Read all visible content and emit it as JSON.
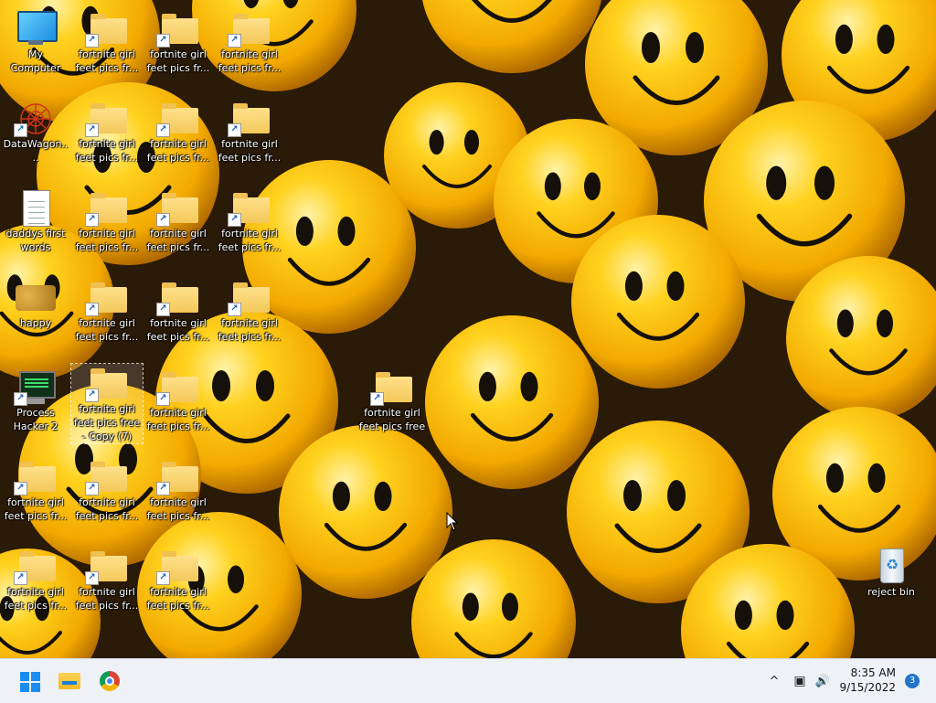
{
  "desktop": {
    "wallpaper": "yellow smiley face balls",
    "cursor": "arrow-pointer",
    "icons": [
      {
        "label": "My Computer",
        "type": "computer"
      },
      {
        "label": "fortnite girl feet pics fr...",
        "type": "folder-shortcut"
      },
      {
        "label": "fortnite girl feet pics fr...",
        "type": "folder-shortcut"
      },
      {
        "label": "fortnite girl feet pics fr...",
        "type": "folder-shortcut"
      },
      {
        "label": "DataWagon....",
        "type": "app-shortcut"
      },
      {
        "label": "fortnite girl feet pics fr...",
        "type": "folder-shortcut"
      },
      {
        "label": "fortnite girl feet pics fr...",
        "type": "folder-shortcut"
      },
      {
        "label": "fortnite girl feet pics fr...",
        "type": "folder-shortcut"
      },
      {
        "label": "daddys first words",
        "type": "text-document"
      },
      {
        "label": "fortnite girl feet pics fr...",
        "type": "folder-shortcut"
      },
      {
        "label": "fortnite girl feet pics fr...",
        "type": "folder-shortcut"
      },
      {
        "label": "fortnite girl feet pics fr...",
        "type": "folder-shortcut"
      },
      {
        "label": "happy",
        "type": "image"
      },
      {
        "label": "fortnite girl feet pics fr...",
        "type": "folder-shortcut"
      },
      {
        "label": "fortnite girl feet pics fr...",
        "type": "folder-shortcut"
      },
      {
        "label": "fortnite girl feet pics fr...",
        "type": "folder-shortcut"
      },
      {
        "label": "Process Hacker 2",
        "type": "app-shortcut"
      },
      {
        "label": "fortnite girl feet pics free - Copy (7)",
        "type": "folder-shortcut",
        "selected": true
      },
      {
        "label": "fortnite girl feet pics fr...",
        "type": "folder-shortcut"
      },
      {
        "label": "fortnite girl feet pics free",
        "type": "folder-shortcut"
      },
      {
        "label": "fortnite girl feet pics fr...",
        "type": "folder-shortcut"
      },
      {
        "label": "fortnite girl feet pics fr...",
        "type": "folder-shortcut"
      },
      {
        "label": "fortnite girl feet pics fr...",
        "type": "folder-shortcut"
      },
      {
        "label": "fortnite girl feet pics fr...",
        "type": "folder-shortcut"
      },
      {
        "label": "fortnite girl feet pics fr...",
        "type": "folder-shortcut"
      },
      {
        "label": "fortnite girl feet pics fr...",
        "type": "folder-shortcut"
      },
      {
        "label": "reject bin",
        "type": "recycle-bin"
      }
    ]
  },
  "taskbar": {
    "pinned": [
      {
        "name": "start-button",
        "icon": "windows-logo-icon"
      },
      {
        "name": "file-explorer",
        "icon": "folder-icon"
      },
      {
        "name": "google-chrome",
        "icon": "chrome-icon"
      }
    ],
    "tray": {
      "overflow_glyph": "^",
      "network_glyph": "▣",
      "volume_glyph": "🔊",
      "time": "8:35 AM",
      "date": "9/15/2022",
      "notification_count": "3"
    }
  },
  "colors": {
    "taskbar_bg": "#eef1f6",
    "accent": "#1b8df0",
    "folder": "#f3c85a",
    "wallpaper_ball": "#f6b400"
  }
}
